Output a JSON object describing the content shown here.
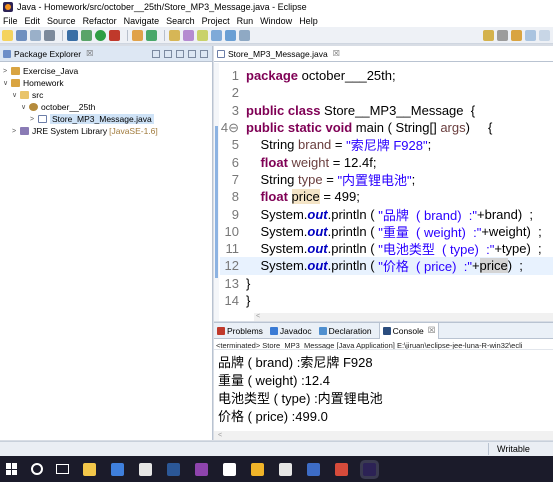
{
  "window": {
    "title": "Java - Homework/src/october__25th/Store_MP3_Message.java - Eclipse",
    "app_icon": "eclipse-icon"
  },
  "menu": {
    "items": [
      "File",
      "Edit",
      "Source",
      "Refactor",
      "Navigate",
      "Search",
      "Project",
      "Run",
      "Window",
      "Help"
    ]
  },
  "package_explorer": {
    "tab_label": "Package Explorer",
    "close_glyph": "☒",
    "tree": [
      {
        "label": "Exercise_Java",
        "arrow": ">",
        "icon": "project-icon"
      },
      {
        "label": "Homework",
        "arrow": "∨",
        "icon": "project-icon"
      },
      {
        "label": "src",
        "arrow": "∨",
        "icon": "source-folder-icon"
      },
      {
        "label": "october__25th",
        "arrow": "∨",
        "icon": "package-icon"
      },
      {
        "label": "Store_MP3_Message.java",
        "arrow": ">",
        "icon": "java-file-icon"
      },
      {
        "label": "JRE System Library",
        "extra": "[JavaSE-1.6]",
        "arrow": ">",
        "icon": "library-icon"
      }
    ]
  },
  "editor": {
    "tab_label": "Store_MP3_Message.java",
    "close_glyph": "☒",
    "lines": [
      {
        "n": "1",
        "parts": [
          [
            "kw",
            "package "
          ],
          [
            "",
            "october___25th;"
          ]
        ]
      },
      {
        "n": "2",
        "parts": []
      },
      {
        "n": "3",
        "parts": [
          [
            "kw",
            "public class "
          ],
          [
            "",
            "Store__MP3__Message  {"
          ]
        ]
      },
      {
        "n": "4⊖",
        "parts": [
          [
            "kw",
            "public static void "
          ],
          [
            "",
            "main ( String[] "
          ],
          [
            "var",
            "args"
          ],
          [
            "",
            ")     {"
          ]
        ]
      },
      {
        "n": "5",
        "parts": [
          [
            "",
            "    String "
          ],
          [
            "var",
            "brand"
          ],
          [
            "",
            " = "
          ],
          [
            "str",
            "\"索尼牌 F928\""
          ],
          [
            "",
            ";"
          ]
        ]
      },
      {
        "n": "6",
        "parts": [
          [
            "",
            "    "
          ],
          [
            "kw",
            "float "
          ],
          [
            "var",
            "weight"
          ],
          [
            "",
            " = 12.4f;"
          ]
        ]
      },
      {
        "n": "7",
        "parts": [
          [
            "",
            "    String "
          ],
          [
            "var",
            "type"
          ],
          [
            "",
            " = "
          ],
          [
            "str",
            "\"内置锂电池\""
          ],
          [
            "",
            ";"
          ]
        ]
      },
      {
        "n": "8",
        "parts": [
          [
            "",
            "    "
          ],
          [
            "kw",
            "float "
          ],
          [
            "hl2",
            "price"
          ],
          [
            "",
            " = 499;"
          ]
        ]
      },
      {
        "n": "9",
        "parts": [
          [
            "",
            "    System."
          ],
          [
            "fld",
            "out"
          ],
          [
            "",
            ".println ( "
          ],
          [
            "str",
            "\"品牌  ( brand)  :\""
          ],
          [
            "",
            "+brand)  ;"
          ]
        ]
      },
      {
        "n": "10",
        "parts": [
          [
            "",
            "    System."
          ],
          [
            "fld",
            "out"
          ],
          [
            "",
            ".println ( "
          ],
          [
            "str",
            "\"重量  ( weight)  :\""
          ],
          [
            "",
            "+weight)  ;"
          ]
        ]
      },
      {
        "n": "11",
        "parts": [
          [
            "",
            "    System."
          ],
          [
            "fld",
            "out"
          ],
          [
            "",
            ".println ( "
          ],
          [
            "str",
            "\"电池类型  ( type)  :\""
          ],
          [
            "",
            "+type)  ;"
          ]
        ]
      },
      {
        "n": "12",
        "parts": [
          [
            "",
            "    System."
          ],
          [
            "fld",
            "out"
          ],
          [
            "",
            ".println ( "
          ],
          [
            "str",
            "\"价格  ( price)  :\""
          ],
          [
            "",
            "+"
          ],
          [
            "hl",
            "price"
          ],
          [
            "",
            ")  ;"
          ]
        ],
        "current": true
      },
      {
        "n": "13",
        "parts": [
          [
            "",
            "}"
          ]
        ]
      },
      {
        "n": "14",
        "parts": [
          [
            "",
            "}"
          ]
        ]
      }
    ]
  },
  "bottom_panel": {
    "tabs": [
      {
        "label": "Problems",
        "icon": "problems-icon",
        "color": "#c0392b"
      },
      {
        "label": "Javadoc",
        "icon": "javadoc-icon",
        "color": "#3a7bd5"
      },
      {
        "label": "Declaration",
        "icon": "declaration-icon",
        "color": "#4f8fcf"
      },
      {
        "label": "Console",
        "icon": "console-icon",
        "color": "#2b4d7e",
        "active": true,
        "close": "☒"
      }
    ],
    "terminated": "<terminated> Store_MP3_Message [Java Application] E:\\jiruan\\eclipse-jee-luna-R-win32\\ecli",
    "console_lines": [
      "品牌  ( brand)  :索尼牌 F928",
      "重量  ( weight)  :12.4",
      "电池类型  ( type)  :内置锂电池",
      "价格  ( price)  :499.0"
    ]
  },
  "status": {
    "writable": "Writable"
  },
  "taskbar": {
    "apps": [
      {
        "icon": "file-explorer-icon",
        "color": "#f3c74a"
      },
      {
        "icon": "edge-icon",
        "color": "#3f7fdc"
      },
      {
        "icon": "notepad-icon",
        "color": "#e6e6e6"
      },
      {
        "icon": "word-icon",
        "color": "#2b5797"
      },
      {
        "icon": "onenote-icon",
        "color": "#8e44ad"
      },
      {
        "icon": "document-icon",
        "color": "#ffffff"
      },
      {
        "icon": "paint-icon",
        "color": "#f0b429"
      },
      {
        "icon": "settings-icon",
        "color": "#e6e6e6"
      },
      {
        "icon": "media-player-icon",
        "color": "#3d6cc6"
      },
      {
        "icon": "chrome-icon",
        "color": "#d64b3b"
      },
      {
        "icon": "eclipse-icon",
        "color": "#2c2255",
        "active": true
      }
    ]
  }
}
